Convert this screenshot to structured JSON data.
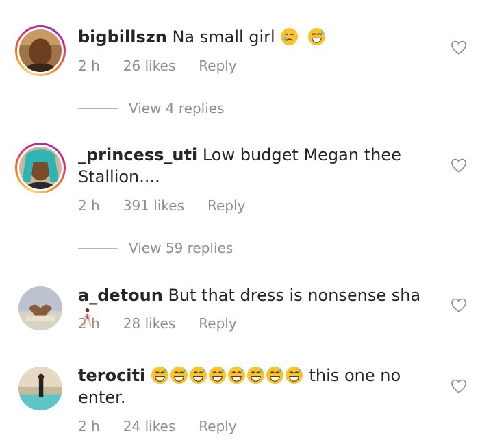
{
  "comments": [
    {
      "username": "bigbillszn",
      "text": "Na small girl",
      "time": "2 h",
      "likes": "26 likes",
      "reply": "Reply",
      "view_replies": "View 4 replies"
    },
    {
      "username": "_princess_uti",
      "text": "Low budget Megan thee Stallion....",
      "time": "2 h",
      "likes": "391 likes",
      "reply": "Reply",
      "view_replies": "View 59 replies"
    },
    {
      "username": "a_detoun",
      "text": "But that dress is nonsense sha",
      "time": "2 h",
      "likes": "28 likes",
      "reply": "Reply"
    },
    {
      "username": "terociti",
      "text": "this one no enter.",
      "time": "2 h",
      "likes": "24 likes",
      "reply": "Reply"
    }
  ],
  "icons": {
    "like": "heart-outline-icon",
    "emoji_cry": "crying-face-emoji",
    "emoji_laugh": "grinning-sweat-emoji",
    "emoji_walk": "woman-walking-emoji"
  },
  "colors": {
    "username": "#262626",
    "meta": "#8e8e8e",
    "emoji": "#f8c331"
  }
}
